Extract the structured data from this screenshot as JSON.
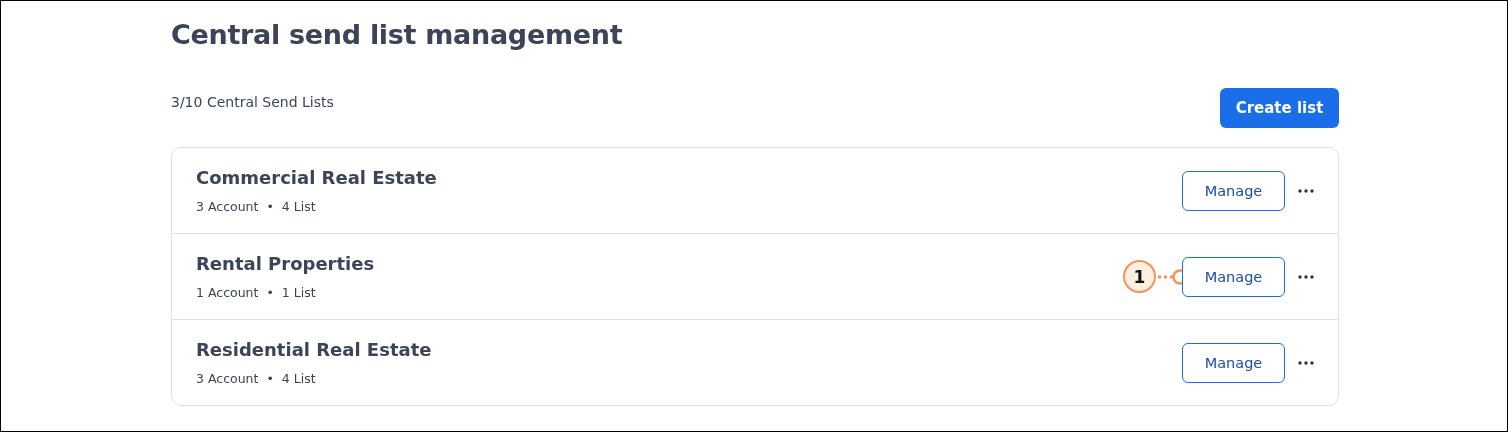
{
  "title": "Central send list management",
  "count": "3/10 Central Send Lists",
  "create_button": "Create list",
  "lists": [
    {
      "name": "Commercial Real Estate",
      "accounts": "3 Account",
      "separator": "•",
      "lists": "4 List",
      "button": "Manage"
    },
    {
      "name": "Rental Properties",
      "accounts": "1 Account",
      "separator": "•",
      "lists": "1 List",
      "button": "Manage",
      "callout": "1"
    },
    {
      "name": "Residential Real Estate",
      "accounts": "3 Account",
      "separator": "•",
      "lists": "4 List",
      "button": "Manage"
    }
  ]
}
